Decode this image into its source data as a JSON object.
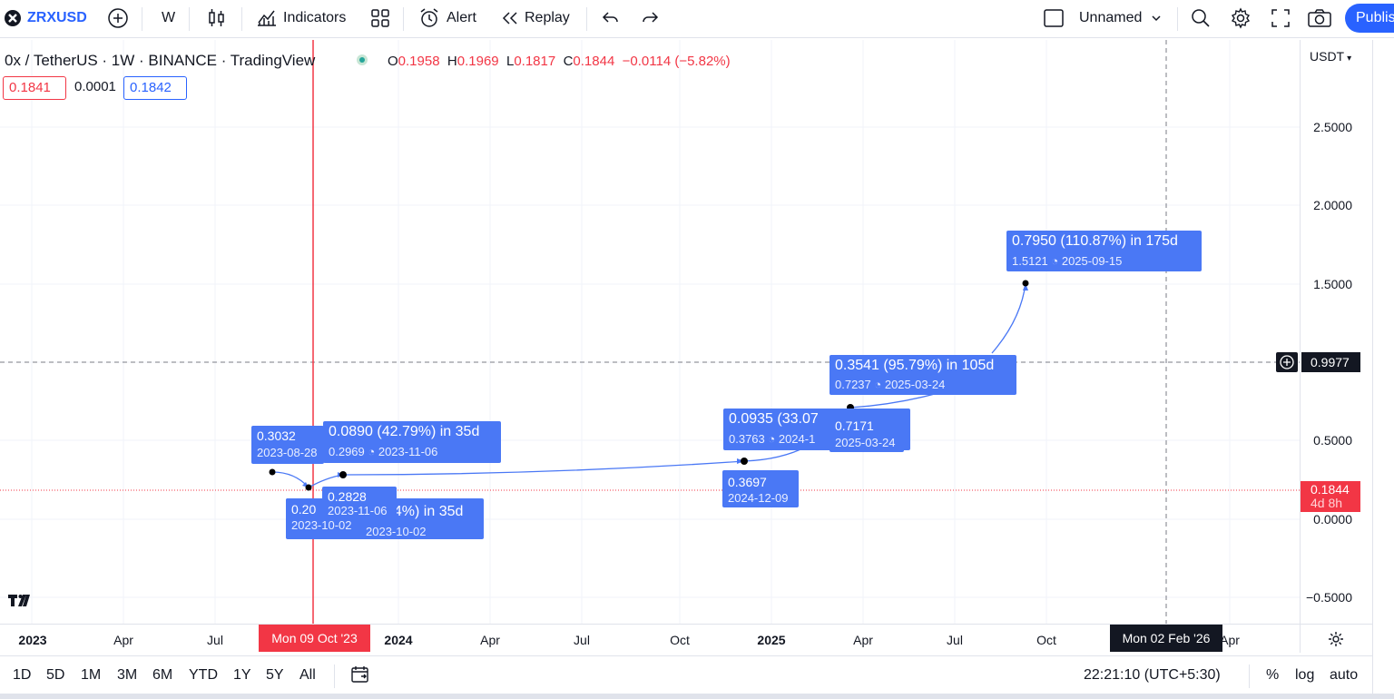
{
  "toolbar": {
    "symbol": "ZRXUSD",
    "interval": "W",
    "indicators_label": "Indicators",
    "alert_label": "Alert",
    "replay_label": "Replay",
    "layout_name": "Unnamed",
    "publish_label": "Publish"
  },
  "legend": {
    "title": "0x / TetherUS · 1W · BINANCE · TradingView",
    "open_key": "O",
    "open": "0.1958",
    "high_key": "H",
    "high": "0.1969",
    "low_key": "L",
    "low": "0.1817",
    "close_key": "C",
    "close": "0.1844",
    "change": "−0.0114 (−5.82%)",
    "bid": "0.1841",
    "spread": "0.0001",
    "ask": "0.1842"
  },
  "price_axis": {
    "currency": "USDT",
    "ticks": [
      "2.5000",
      "2.0000",
      "1.5000",
      "1.0000",
      "0.5000",
      "0.0000",
      "−0.5000"
    ],
    "crosshair_price": "0.9977",
    "last_price": "0.1844",
    "countdown": "4d 8h"
  },
  "time_axis": {
    "ticks": [
      "2023",
      "Apr",
      "Jul",
      "2024",
      "Apr",
      "Jul",
      "Oct",
      "2025",
      "Apr",
      "Jul",
      "Oct",
      "Apr"
    ],
    "selected_date": "Mon 09 Oct '23",
    "crosshair_date": "Mon 02 Feb '26"
  },
  "annotations": {
    "a1": {
      "price": "0.3032",
      "date": "2023-08-28"
    },
    "a2": {
      "main": "0.0890 (42.79%) in 35d",
      "price": "0.2969",
      "date": "2023-11-06"
    },
    "a3": {
      "main": "0.20",
      "date": "2023-10-02"
    },
    "a4": {
      "main": "0.2828",
      "date": "2023-11-06"
    },
    "a5": {
      "main": "44%) in 35d",
      "date": "2023-10-02"
    },
    "a6": {
      "main": "0.0935 (33.07",
      "price": "0.3763",
      "date": "2024-1"
    },
    "a7": {
      "price": "0.7171",
      "date": "2025-03-24"
    },
    "a8": {
      "price": "0.3697",
      "date": "2024-12-09"
    },
    "a9": {
      "main": "0.3541 (95.79%) in 105d",
      "price": "0.7237",
      "date": "2025-03-24"
    },
    "a10": {
      "main": "0.7950 (110.87%) in 175d",
      "price": "1.5121",
      "date": "2025-09-15"
    }
  },
  "bottombar": {
    "ranges": [
      "1D",
      "5D",
      "1M",
      "3M",
      "6M",
      "YTD",
      "1Y",
      "5Y",
      "All"
    ],
    "clock": "22:21:10 (UTC+5:30)",
    "percent_label": "%",
    "log_label": "log",
    "auto_label": "auto"
  },
  "colors": {
    "accent": "#2962ff",
    "label_blue": "#4a78f5",
    "down": "#f23645",
    "up": "#26a69a"
  },
  "icons": [
    "zrx-logo-icon",
    "add-symbol-icon",
    "candles-icon",
    "indicators-icon",
    "templates-icon",
    "alert-icon",
    "replay-icon",
    "undo-icon",
    "redo-icon",
    "layout-icon",
    "chevron-down-icon",
    "search-icon",
    "gear-icon",
    "fullscreen-icon",
    "camera-icon",
    "calendar-icon",
    "settings-icon",
    "tv-logo-icon"
  ]
}
